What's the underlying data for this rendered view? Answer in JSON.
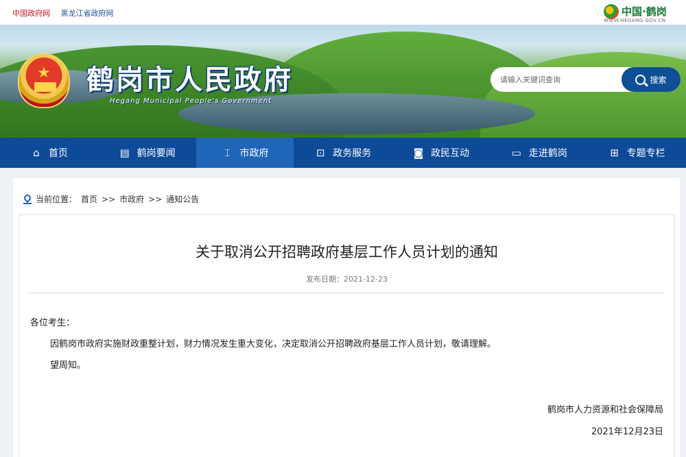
{
  "topbar": {
    "link_china_gov": "中国政府网",
    "link_heilongjiang": "黑龙江省政府网",
    "brand_name": "中国·鹤岗",
    "brand_url": "WWW.HEGANG.GOV.CN"
  },
  "header": {
    "title": "鹤岗市人民政府",
    "subtitle": "Hegang Municipal People's Government",
    "search_placeholder": "请输入关键词查询",
    "search_button": "搜索"
  },
  "nav": {
    "items": [
      {
        "label": "首页",
        "icon": "home-icon",
        "glyph": "⌂"
      },
      {
        "label": "鹤岗要闻",
        "icon": "document-icon",
        "glyph": "▤"
      },
      {
        "label": "市政府",
        "icon": "government-building-icon",
        "glyph": "⌶"
      },
      {
        "label": "政务服务",
        "icon": "service-icon",
        "glyph": "⊡"
      },
      {
        "label": "政民互动",
        "icon": "chat-icon",
        "glyph": "◙"
      },
      {
        "label": "走进鹤岗",
        "icon": "monitor-icon",
        "glyph": "▭"
      },
      {
        "label": "专题专栏",
        "icon": "grid-icon",
        "glyph": "⊞"
      }
    ],
    "active_index": 2
  },
  "breadcrumb": {
    "prefix": "当前位置：",
    "items": [
      "首页",
      "市政府",
      "通知公告"
    ],
    "separator": ">>"
  },
  "article": {
    "title": "关于取消公开招聘政府基层工作人员计划的通知",
    "date_label": "发布日期：2021-12-23",
    "salutation": "各位考生：",
    "paragraph1": "因鹤岗市政府实施财政重整计划，财力情况发生重大变化，决定取消公开招聘政府基层工作人员计划，敬请理解。",
    "paragraph2": "望周知。",
    "signature_org": "鹤岗市人力资源和社会保障局",
    "signature_date": "2021年12月23日"
  },
  "colors": {
    "nav_bg": "#0d4a98",
    "nav_active": "#1f65b8",
    "link_red": "#c8161d",
    "link_blue": "#1a4fa0"
  }
}
